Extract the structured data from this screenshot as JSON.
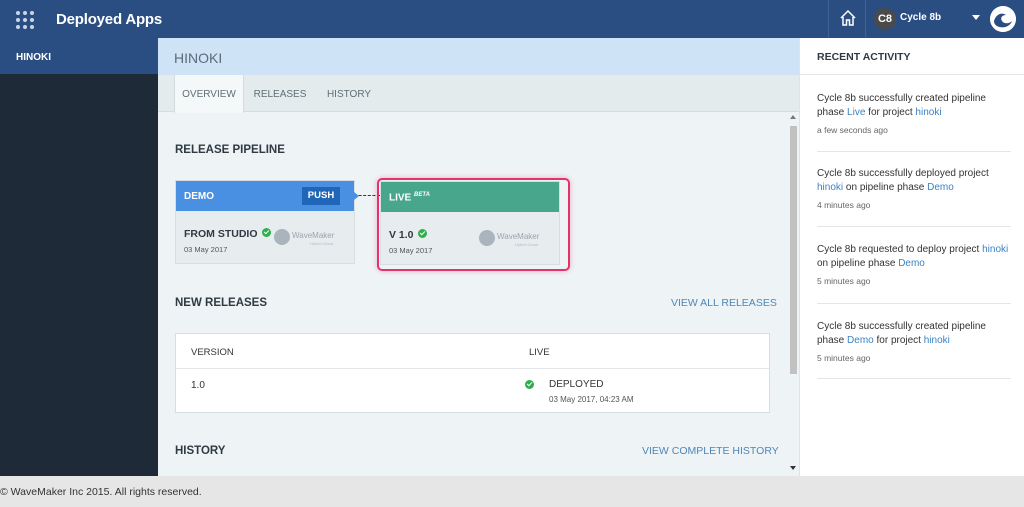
{
  "header": {
    "app_title": "Deployed Apps",
    "user_initials": "C8",
    "user_name": "Cycle 8b",
    "icons": [
      "apps-grid-icon",
      "home-icon",
      "user-caret-icon",
      "brand-logo-icon"
    ]
  },
  "sidebar": {
    "items": [
      {
        "label": "HINOKI",
        "active": true
      }
    ]
  },
  "project": {
    "title": "HINOKI",
    "tabs": [
      {
        "label": "OVERVIEW",
        "active": true
      },
      {
        "label": "RELEASES",
        "active": false
      },
      {
        "label": "HISTORY",
        "active": false
      }
    ]
  },
  "pipeline": {
    "title": "RELEASE PIPELINE",
    "phases": [
      {
        "name": "DEMO",
        "badge": "",
        "button": "PUSH",
        "build": "FROM STUDIO",
        "date": "03 May 2017",
        "color": "#4a90e2",
        "logo_text": "WaveMaker",
        "logo_sub": "Hybrid Cloud"
      },
      {
        "name": "LIVE",
        "badge": "BETA",
        "button": "",
        "build": "V 1.0",
        "date": "03 May 2017",
        "color": "#48a68c",
        "logo_text": "WaveMaker",
        "logo_sub": "Hybrid Cloud"
      }
    ]
  },
  "new_releases": {
    "title": "NEW RELEASES",
    "view_all_label": "VIEW ALL RELEASES",
    "columns": [
      "VERSION",
      "LIVE"
    ],
    "rows": [
      {
        "version": "1.0",
        "status": "DEPLOYED",
        "date": "03 May 2017, 04:23 AM"
      }
    ]
  },
  "history": {
    "title": "HISTORY",
    "view_label": "VIEW COMPLETE HISTORY"
  },
  "recent_activity": {
    "title": "RECENT ACTIVITY",
    "items": [
      {
        "pre": "Cycle 8b successfully created pipeline phase ",
        "link1": "Live",
        "mid": " for project ",
        "link2": "hinoki",
        "post": "",
        "time": "a few seconds ago"
      },
      {
        "pre": "Cycle 8b successfully deployed project ",
        "link1": "hinoki",
        "mid": " on pipeline phase ",
        "link2": "Demo",
        "post": "",
        "time": "4 minutes ago"
      },
      {
        "pre": "Cycle 8b requested to deploy project ",
        "link1": "hinoki",
        "mid": " on pipeline phase ",
        "link2": "Demo",
        "post": "",
        "time": "5 minutes ago"
      },
      {
        "pre": "Cycle 8b successfully created pipeline phase ",
        "link1": "Demo",
        "mid": " for project ",
        "link2": "hinoki",
        "post": "",
        "time": "5 minutes ago"
      }
    ]
  },
  "footer": {
    "text": "© WaveMaker Inc 2015. All rights reserved."
  },
  "colors": {
    "header": "#2b4e82",
    "sidebar": "#1f2a38",
    "demo": "#4a90e2",
    "live": "#48a68c",
    "highlight": "#e2336b",
    "link": "#3b82c4"
  }
}
